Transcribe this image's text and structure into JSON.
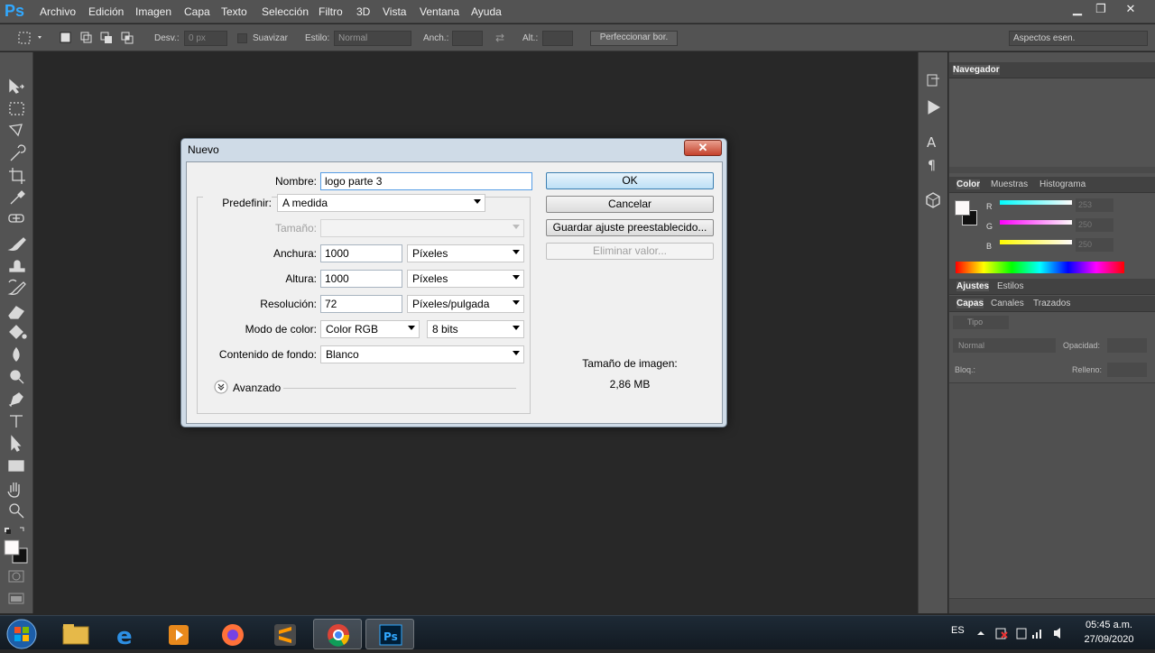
{
  "app": {
    "logo": "Ps"
  },
  "menu": [
    "Archivo",
    "Edición",
    "Imagen",
    "Capa",
    "Texto",
    "Selección",
    "Filtro",
    "3D",
    "Vista",
    "Ventana",
    "Ayuda"
  ],
  "window_controls": {
    "minimize": "▁",
    "restore": "❐",
    "close": "✕"
  },
  "options_bar": {
    "feather_label": "Desv.:",
    "feather_value": "0 px",
    "smooth_label": "Suavizar",
    "style_label": "Estilo:",
    "style_value": "Normal",
    "width_label": "Anch.:",
    "height_label": "Alt.:",
    "refine_label": "Perfeccionar bor.",
    "workspace": "Aspectos esen."
  },
  "dialog": {
    "title": "Nuevo",
    "close": "✕",
    "name_label": "Nombre:",
    "name_value": "logo parte 3",
    "preset_label": "Predefinir:",
    "preset_value": "A medida",
    "size_label": "Tamaño:",
    "width_label": "Anchura:",
    "width_value": "1000",
    "width_unit": "Píxeles",
    "height_label": "Altura:",
    "height_value": "1000",
    "height_unit": "Píxeles",
    "resolution_label": "Resolución:",
    "resolution_value": "72",
    "resolution_unit": "Píxeles/pulgada",
    "color_mode_label": "Modo de color:",
    "color_mode_value": "Color RGB",
    "bit_depth": "8 bits",
    "background_label": "Contenido de fondo:",
    "background_value": "Blanco",
    "advanced_label": "Avanzado",
    "ok": "OK",
    "cancel": "Cancelar",
    "save_preset": "Guardar ajuste preestablecido...",
    "delete_preset": "Eliminar valor...",
    "image_size_label": "Tamaño de imagen:",
    "image_size_value": "2,86 MB"
  },
  "panels": {
    "navigator_tab": "Navegador",
    "color_tabs": [
      "Color",
      "Muestras",
      "Histograma"
    ],
    "color_channels": [
      {
        "label": "R",
        "value": "253"
      },
      {
        "label": "G",
        "value": "250"
      },
      {
        "label": "B",
        "value": "250"
      }
    ],
    "adjust_tabs": [
      "Ajustes",
      "Estilos"
    ],
    "layer_tabs": [
      "Capas",
      "Canales",
      "Trazados"
    ],
    "kind_filter": "Tipo",
    "blend_mode": "Normal",
    "opacity_label": "Opacidad:",
    "lock_label": "Bloq.:",
    "fill_label": "Relleno:"
  },
  "taskbar": {
    "language": "ES",
    "time": "05:45 a.m.",
    "date": "27/09/2020"
  },
  "colors": {
    "ps_blue": "#31a8ff",
    "dialog_frame": "#cfdbe7",
    "ok_blue": "#3c7fb1"
  }
}
